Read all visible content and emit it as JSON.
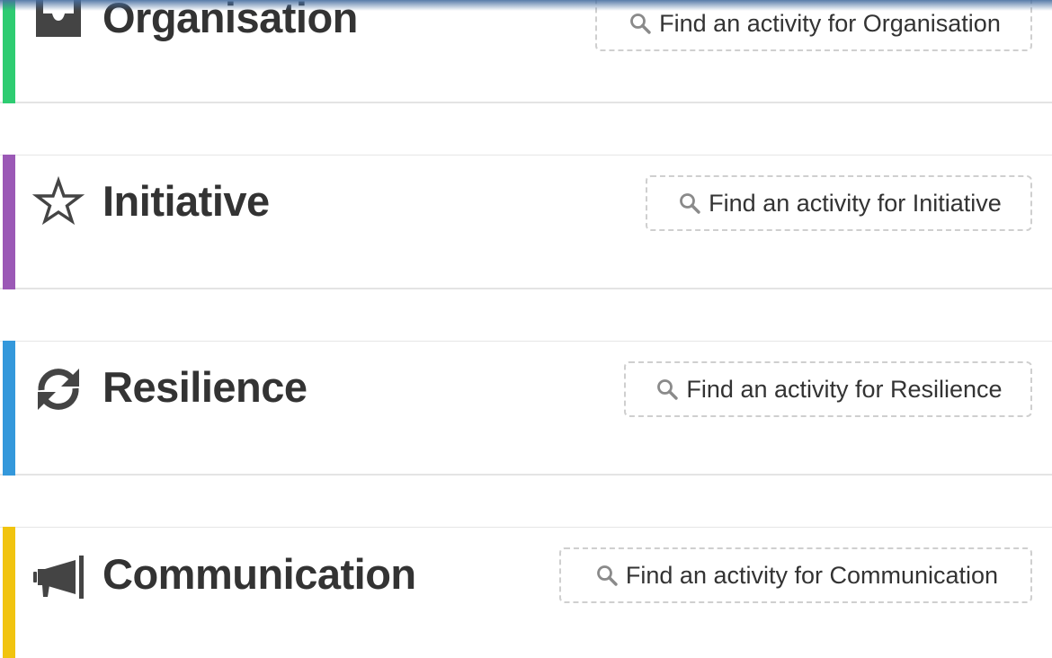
{
  "panels": [
    {
      "title": "Organisation",
      "icon": "inbox-icon",
      "accent": "#2ecc71",
      "search_label": "Find an activity for Organisation"
    },
    {
      "title": "Initiative",
      "icon": "star-icon",
      "accent": "#9b59b6",
      "search_label": "Find an activity for Initiative"
    },
    {
      "title": "Resilience",
      "icon": "refresh-icon",
      "accent": "#3498db",
      "search_label": "Find an activity for Resilience"
    },
    {
      "title": "Communication",
      "icon": "megaphone-icon",
      "accent": "#f1c40f",
      "search_label": "Find an activity for Communication"
    }
  ],
  "colors": {
    "title_text": "#333333",
    "icon": "#444444",
    "search_icon": "#8a8a8a",
    "dashed_border": "#cfcfcf"
  }
}
